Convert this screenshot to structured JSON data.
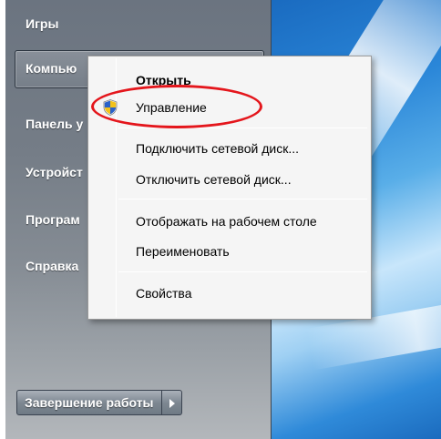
{
  "start_menu": {
    "items": [
      {
        "label": "Игры"
      },
      {
        "label": "Компью"
      },
      {
        "label": "Панель у"
      },
      {
        "label": "Устройст"
      },
      {
        "label": "Програм"
      },
      {
        "label": "Справка"
      }
    ],
    "shutdown_label": "Завершение работы",
    "shutdown_arrow_icon": "chevron-right-icon"
  },
  "context_menu": {
    "items": [
      {
        "label": "Открыть",
        "bold": true
      },
      {
        "label": "Управление",
        "icon": "uac-shield-icon"
      },
      {
        "label": "Подключить сетевой диск..."
      },
      {
        "label": "Отключить сетевой диск..."
      },
      {
        "label": "Отображать на рабочем столе"
      },
      {
        "label": "Переименовать"
      },
      {
        "label": "Свойства"
      }
    ]
  },
  "colors": {
    "annotation": "#e4161c",
    "menu_background": "#f5f5f5"
  }
}
